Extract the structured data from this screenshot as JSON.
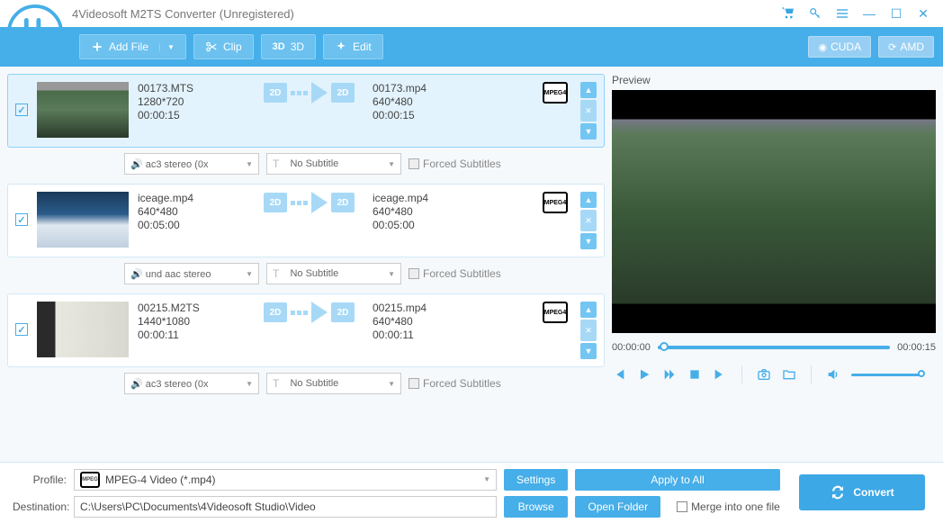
{
  "title": "4Videosoft M2TS Converter (Unregistered)",
  "toolbar": {
    "add_file": "Add File",
    "clip": "Clip",
    "three_d": "3D",
    "edit": "Edit",
    "cuda": "CUDA",
    "amd": "AMD"
  },
  "items": [
    {
      "selected": true,
      "src_name": "00173.MTS",
      "src_res": "1280*720",
      "src_dur": "00:00:15",
      "dst_name": "00173.mp4",
      "dst_res": "640*480",
      "dst_dur": "00:00:15",
      "audio": "ac3 stereo (0x",
      "subtitle": "No Subtitle",
      "forced": "Forced Subtitles"
    },
    {
      "selected": false,
      "src_name": "iceage.mp4",
      "src_res": "640*480",
      "src_dur": "00:05:00",
      "dst_name": "iceage.mp4",
      "dst_res": "640*480",
      "dst_dur": "00:05:00",
      "audio": "und aac stereo",
      "subtitle": "No Subtitle",
      "forced": "Forced Subtitles"
    },
    {
      "selected": false,
      "src_name": "00215.M2TS",
      "src_res": "1440*1080",
      "src_dur": "00:00:11",
      "dst_name": "00215.mp4",
      "dst_res": "640*480",
      "dst_dur": "00:00:11",
      "audio": "ac3 stereo (0x",
      "subtitle": "No Subtitle",
      "forced": "Forced Subtitles"
    }
  ],
  "preview": {
    "label": "Preview",
    "time_current": "00:00:00",
    "time_total": "00:00:15"
  },
  "profile": {
    "label": "Profile:",
    "value": "MPEG-4 Video (*.mp4)",
    "settings": "Settings",
    "apply_all": "Apply to All"
  },
  "destination": {
    "label": "Destination:",
    "value": "C:\\Users\\PC\\Documents\\4Videosoft Studio\\Video",
    "browse": "Browse",
    "open_folder": "Open Folder"
  },
  "merge_label": "Merge into one file",
  "convert_label": "Convert"
}
